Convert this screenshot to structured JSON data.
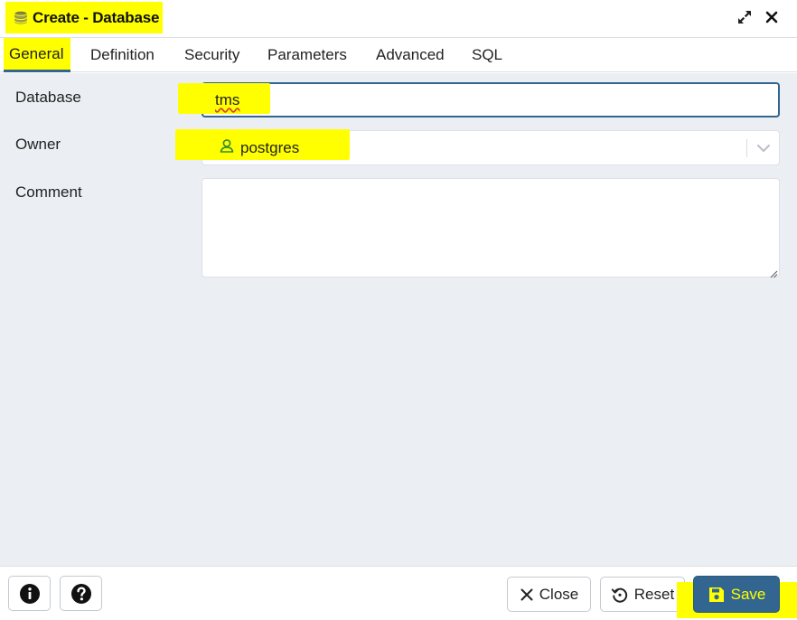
{
  "window": {
    "title": "Create - Database",
    "title_icon": "database-icon",
    "expand_icon": "expand-icon",
    "close_icon": "close-icon"
  },
  "tabs": [
    {
      "label": "General",
      "active": true
    },
    {
      "label": "Definition",
      "active": false
    },
    {
      "label": "Security",
      "active": false
    },
    {
      "label": "Parameters",
      "active": false
    },
    {
      "label": "Advanced",
      "active": false
    },
    {
      "label": "SQL",
      "active": false
    }
  ],
  "form": {
    "database": {
      "label": "Database",
      "value": "tms"
    },
    "owner": {
      "label": "Owner",
      "value": "postgres",
      "icon": "user-icon"
    },
    "comment": {
      "label": "Comment",
      "value": ""
    }
  },
  "footer": {
    "info_icon": "info-icon",
    "help_icon": "help-icon",
    "close_label": "Close",
    "reset_label": "Reset",
    "save_label": "Save"
  },
  "colors": {
    "accent": "#326690",
    "highlight": "#ffff00",
    "form_background": "#ebeef3"
  }
}
